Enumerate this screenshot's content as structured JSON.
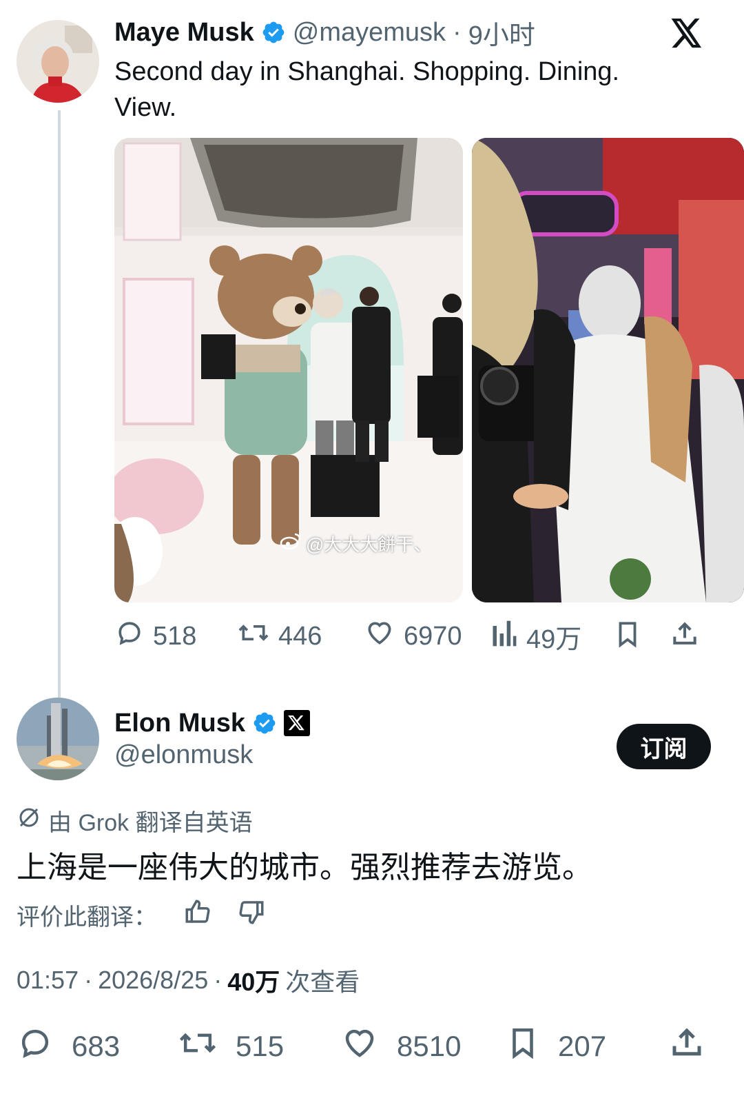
{
  "first_tweet": {
    "author_name": "Maye Musk",
    "handle": "@mayemusk",
    "separator": "·",
    "time_ago": "9小时",
    "text_line1": "Second day in Shanghai. Shopping. Dining.",
    "text_line2": "View.",
    "photo_watermark": "@大大大餅干、",
    "stats": {
      "replies": "518",
      "reposts": "446",
      "likes": "6970",
      "views": "49万"
    }
  },
  "second_tweet": {
    "author_name": "Elon Musk",
    "handle": "@elonmusk",
    "subscribe_label": "订阅",
    "translation_note": "由 Grok 翻译自英语",
    "text": "上海是一座伟大的城市。强烈推荐去游览。",
    "rate_translation_label": "评价此翻译：",
    "meta_time": "01:57",
    "meta_date": "2026/8/25",
    "meta_sep": "·",
    "meta_views_count": "40万",
    "meta_views_label": "次查看",
    "stats": {
      "replies": "683",
      "reposts": "515",
      "likes": "8510",
      "bookmarks": "207"
    }
  },
  "colors": {
    "verified_blue": "#1d9bf0",
    "muted_text": "#536471",
    "primary_text": "#0f1419"
  },
  "icons": [
    "x-logo-icon",
    "verified-badge-icon",
    "reply-icon",
    "repost-icon",
    "like-icon",
    "views-icon",
    "bookmark-icon",
    "share-icon",
    "grok-icon",
    "thumbs-up-icon",
    "thumbs-down-icon"
  ]
}
